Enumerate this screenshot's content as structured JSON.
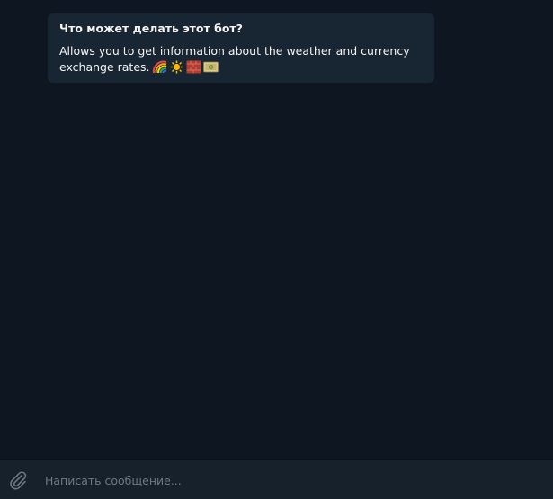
{
  "bot_info": {
    "title": "Что может делать этот бот?",
    "description": "Allows you to get information about the weather and currency exchange rates.",
    "emojis": [
      "rainbow-emoji",
      "sun-emoji",
      "brick-emoji",
      "money-emoji"
    ]
  },
  "composer": {
    "placeholder": "Написать сообщение..."
  },
  "colors": {
    "background": "#0e1621",
    "card": "#182533",
    "composer": "#17212b",
    "text": "#f5f5f5",
    "placeholder": "#6c7883"
  }
}
